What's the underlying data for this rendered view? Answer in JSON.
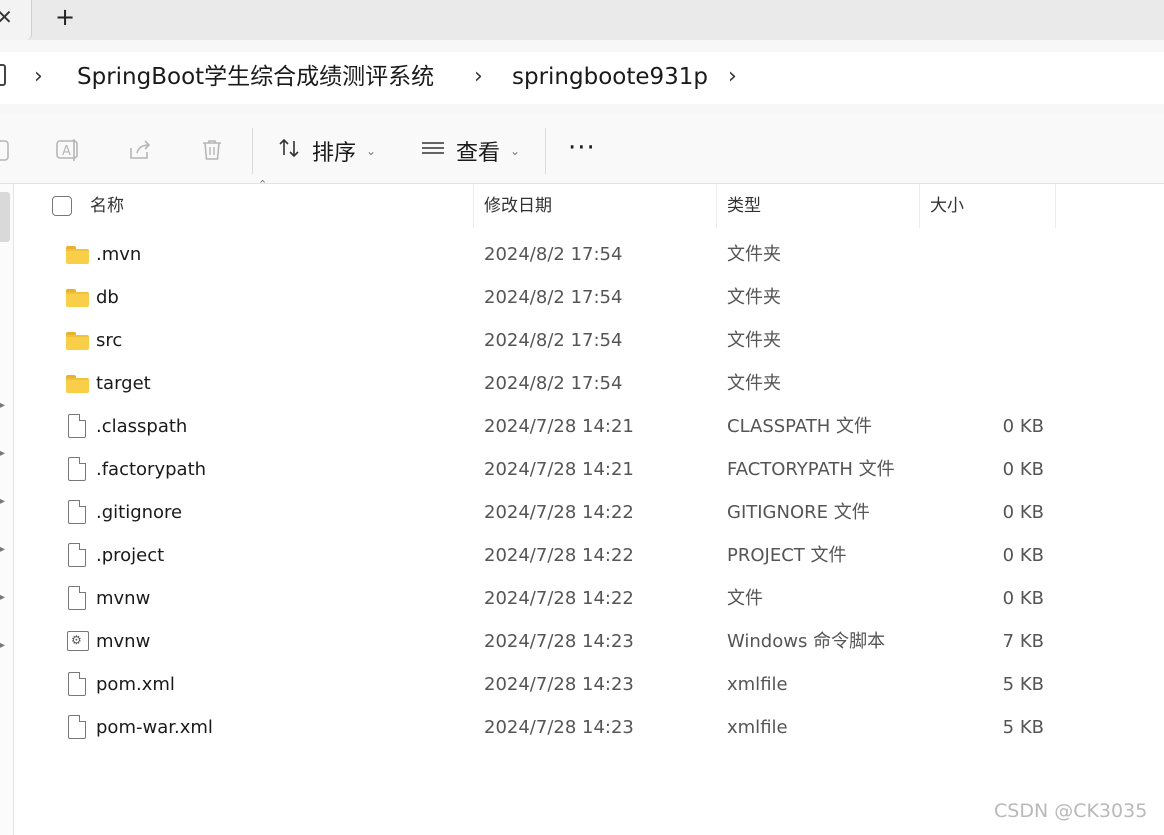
{
  "tabs": {
    "new_tab_label": "+",
    "close_glyph": "✕"
  },
  "breadcrumb": {
    "items": [
      "SpringBoot学生综合成绩测评系统",
      "springboote931p"
    ]
  },
  "toolbar": {
    "sort_label": "排序",
    "view_label": "查看",
    "more_label": "···"
  },
  "header": {
    "name": "名称",
    "date": "修改日期",
    "type": "类型",
    "size": "大小"
  },
  "files": [
    {
      "name": ".mvn",
      "date": "2024/8/2 17:54",
      "type": "文件夹",
      "size": "",
      "icon": "folder-icon"
    },
    {
      "name": "db",
      "date": "2024/8/2 17:54",
      "type": "文件夹",
      "size": "",
      "icon": "folder-icon"
    },
    {
      "name": "src",
      "date": "2024/8/2 17:54",
      "type": "文件夹",
      "size": "",
      "icon": "folder-icon"
    },
    {
      "name": "target",
      "date": "2024/8/2 17:54",
      "type": "文件夹",
      "size": "",
      "icon": "folder-icon"
    },
    {
      "name": ".classpath",
      "date": "2024/7/28 14:21",
      "type": "CLASSPATH 文件",
      "size": "0 KB",
      "icon": "file-icon"
    },
    {
      "name": ".factorypath",
      "date": "2024/7/28 14:21",
      "type": "FACTORYPATH 文件",
      "size": "0 KB",
      "icon": "file-icon"
    },
    {
      "name": ".gitignore",
      "date": "2024/7/28 14:22",
      "type": "GITIGNORE 文件",
      "size": "0 KB",
      "icon": "file-icon"
    },
    {
      "name": ".project",
      "date": "2024/7/28 14:22",
      "type": "PROJECT 文件",
      "size": "0 KB",
      "icon": "file-icon"
    },
    {
      "name": "mvnw",
      "date": "2024/7/28 14:22",
      "type": "文件",
      "size": "0 KB",
      "icon": "file-icon"
    },
    {
      "name": "mvnw",
      "date": "2024/7/28 14:23",
      "type": "Windows 命令脚本",
      "size": "7 KB",
      "icon": "cmd-script-icon"
    },
    {
      "name": "pom.xml",
      "date": "2024/7/28 14:23",
      "type": "xmlfile",
      "size": "5 KB",
      "icon": "file-icon"
    },
    {
      "name": "pom-war.xml",
      "date": "2024/7/28 14:23",
      "type": "xmlfile",
      "size": "5 KB",
      "icon": "file-icon"
    }
  ],
  "watermark": "CSDN @CK3035",
  "colors": {
    "folder": "#f9cf4a",
    "toolbar_bg": "#f9f9f9",
    "tabstrip_bg": "#eaeaea"
  }
}
